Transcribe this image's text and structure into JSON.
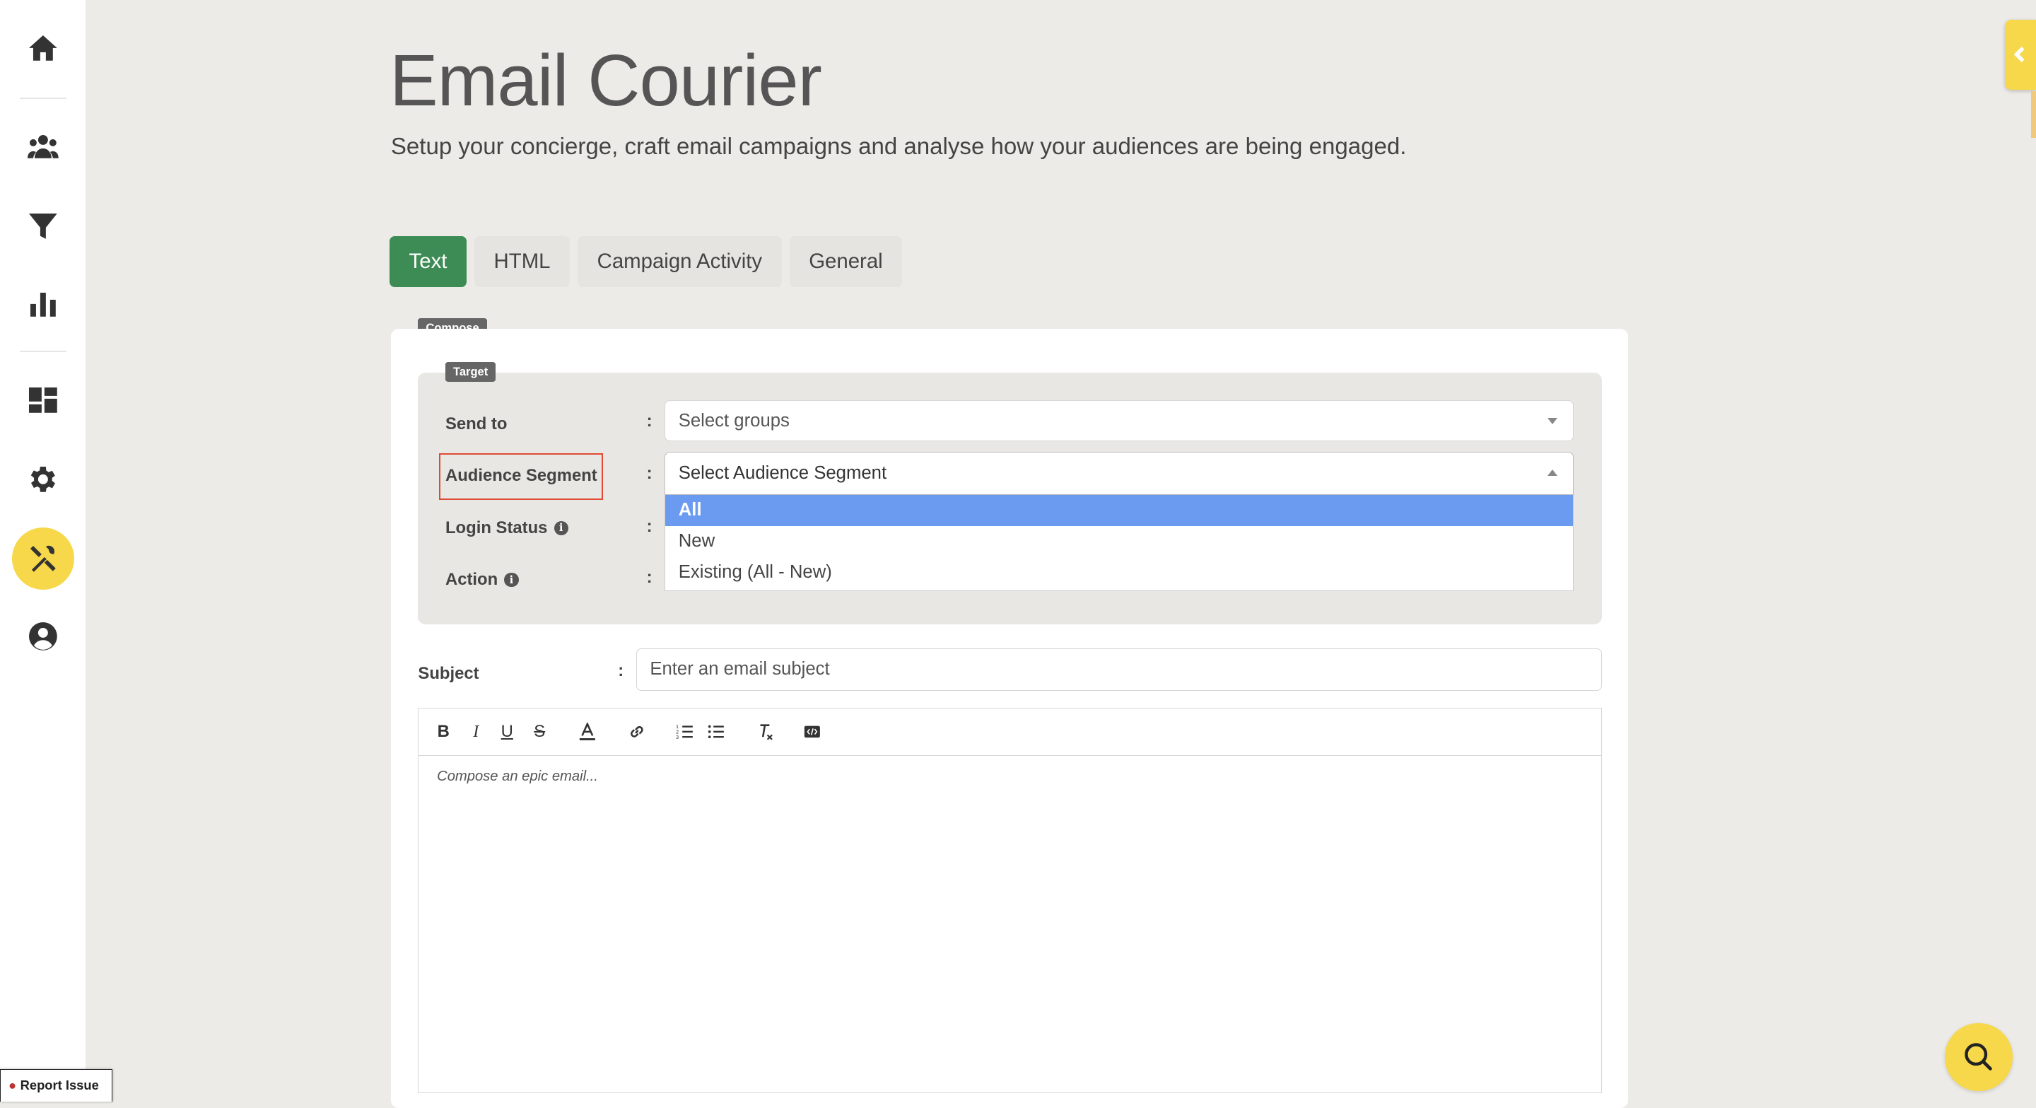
{
  "header": {
    "title": "Email Courier",
    "subtitle": "Setup your concierge, craft email campaigns and analyse how your audiences are being engaged."
  },
  "tabs": [
    {
      "label": "Text",
      "active": true
    },
    {
      "label": "HTML",
      "active": false
    },
    {
      "label": "Campaign Activity",
      "active": false
    },
    {
      "label": "General",
      "active": false
    }
  ],
  "compose": {
    "legend": "Compose",
    "target": {
      "legend": "Target",
      "send_to": {
        "label": "Send to",
        "placeholder": "Select groups"
      },
      "audience_segment": {
        "label": "Audience Segment",
        "placeholder": "Select Audience Segment",
        "options": [
          "All",
          "New",
          "Existing (All - New)"
        ],
        "highlighted_option": "All"
      },
      "login_status": {
        "label": "Login Status"
      },
      "action": {
        "label": "Action"
      },
      "colon": ":"
    },
    "subject": {
      "label": "Subject",
      "placeholder": "Enter an email subject"
    },
    "editor": {
      "placeholder": "Compose an epic email...",
      "toolbar": [
        "bold-icon",
        "italic-icon",
        "underline-icon",
        "strikethrough-icon",
        "font-color-icon",
        "link-icon",
        "ordered-list-icon",
        "bullet-list-icon",
        "clear-format-icon",
        "code-icon"
      ]
    }
  },
  "sidebar": {
    "items": [
      "home-icon",
      "users-icon",
      "filter-icon",
      "chart-icon",
      "dashboard-icon",
      "settings-icon",
      "tools-icon",
      "account-icon"
    ],
    "active": "tools-icon"
  },
  "report_issue": {
    "label": "Report Issue"
  },
  "colors": {
    "accent": "#f7d84a",
    "active_tab": "#3d8c55",
    "highlight": "#e04a35",
    "selected_option": "#6b9bf0"
  }
}
